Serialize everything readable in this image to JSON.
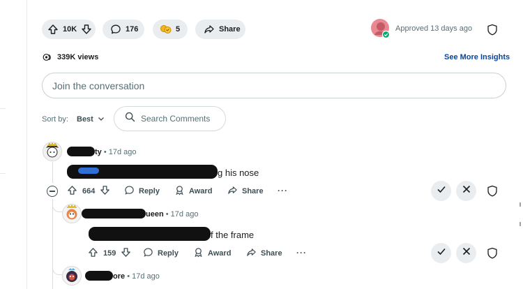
{
  "post_actions": {
    "upvote_count": "10K",
    "comments_count": "176",
    "awards_count": "5",
    "share_label": "Share",
    "approved_text": "Approved 13 days ago"
  },
  "stats": {
    "views": "339K views",
    "insights_link": "See More Insights"
  },
  "composer": {
    "placeholder": "Join the conversation"
  },
  "sort": {
    "label": "Sort by:",
    "value": "Best"
  },
  "search": {
    "placeholder": "Search Comments"
  },
  "comments": [
    {
      "author_visible": "ty",
      "time": "17d ago",
      "text_visible": "g his nose",
      "votes": "664",
      "reply_label": "Reply",
      "award_label": "Award",
      "share_label": "Share",
      "more_label": "···"
    },
    {
      "author_visible": "ueen",
      "time": "17d ago",
      "text_visible": "f the frame",
      "votes": "159",
      "reply_label": "Reply",
      "award_label": "Award",
      "share_label": "Share",
      "more_label": "···"
    },
    {
      "author_visible": "ore",
      "time": "17d ago"
    }
  ],
  "colors": {
    "pill_bg": "#eaedef",
    "link_blue": "#0a449b",
    "muted_text": "#576f76",
    "approved_green": "#00a96e",
    "avatar_pink": "#e98891"
  }
}
